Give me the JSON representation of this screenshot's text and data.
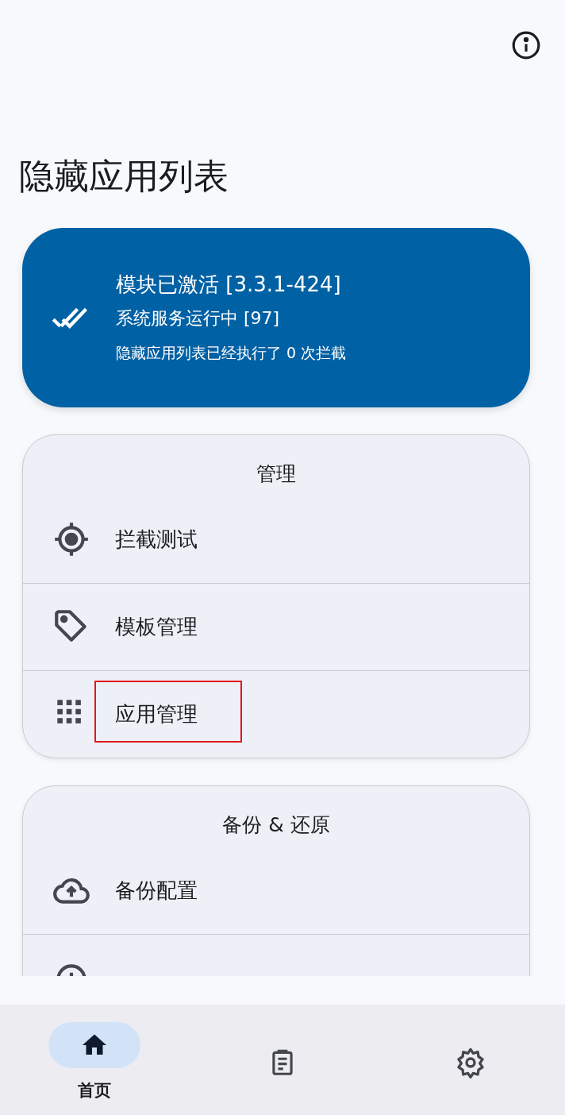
{
  "title": "隐藏应用列表",
  "status_card": {
    "title": "模块已激活 [3.3.1-424]",
    "service": "系统服务运行中 [97]",
    "stats": "隐藏应用列表已经执行了 0 次拦截"
  },
  "sections": [
    {
      "header": "管理",
      "items": [
        {
          "kind": "target",
          "label": "拦截测试",
          "highlighted": false
        },
        {
          "kind": "tag",
          "label": "模板管理",
          "highlighted": false
        },
        {
          "kind": "grid",
          "label": "应用管理",
          "highlighted": true
        }
      ]
    },
    {
      "header": "备份 & 还原",
      "items": [
        {
          "kind": "cloud",
          "label": "备份配置",
          "highlighted": false
        },
        {
          "kind": "restore",
          "highlighted": false
        }
      ]
    }
  ],
  "nav": [
    {
      "kind": "home",
      "label": "首页",
      "selected": true
    },
    {
      "kind": "logs",
      "selected": false
    },
    {
      "kind": "settings",
      "selected": false
    }
  ]
}
